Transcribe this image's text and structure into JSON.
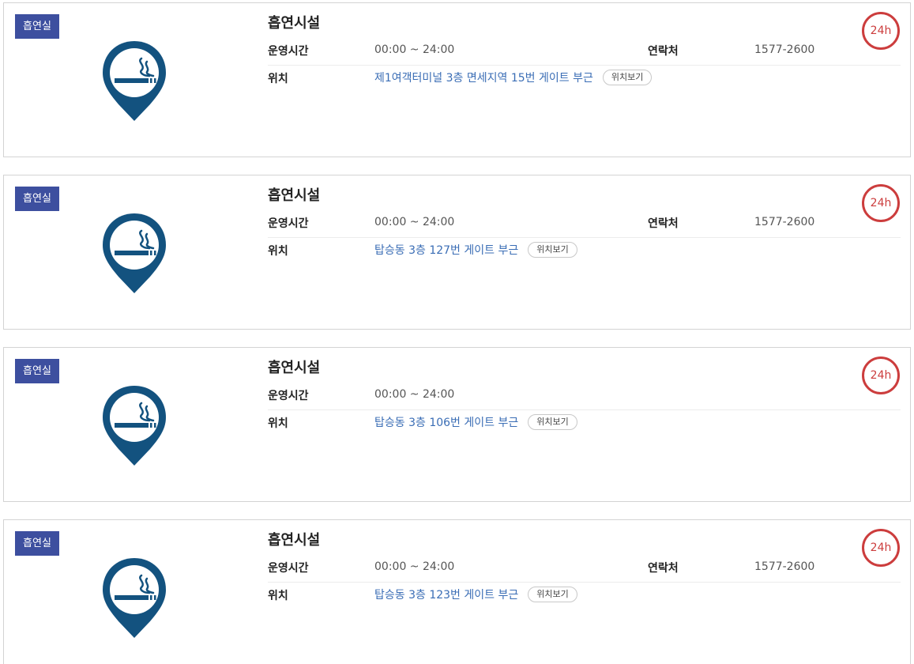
{
  "colors": {
    "badge_bg": "#3d4f9f",
    "pin": "#13527f",
    "ring": "#cc3d3d",
    "link": "#3a6db5"
  },
  "icons": {
    "pin": "smoking-area-pin-icon"
  },
  "facilities": [
    {
      "badge": "흡연실",
      "title": "흡연시설",
      "hours_label": "운영시간",
      "hours": "00:00 ~ 24:00",
      "contact_label": "연락처",
      "contact": "1577-2600",
      "location_label": "위치",
      "location": "제1여객터미널 3층 면세지역 15번 게이트 부근",
      "view_button": "위치보기",
      "ring": "24h"
    },
    {
      "badge": "흡연실",
      "title": "흡연시설",
      "hours_label": "운영시간",
      "hours": "00:00 ~ 24:00",
      "contact_label": "연락처",
      "contact": "1577-2600",
      "location_label": "위치",
      "location": "탑승동 3층 127번 게이트 부근",
      "view_button": "위치보기",
      "ring": "24h"
    },
    {
      "badge": "흡연실",
      "title": "흡연시설",
      "hours_label": "운영시간",
      "hours": "00:00 ~ 24:00",
      "location_label": "위치",
      "location": "탑승동 3층 106번 게이트 부근",
      "view_button": "위치보기",
      "ring": "24h"
    },
    {
      "badge": "흡연실",
      "title": "흡연시설",
      "hours_label": "운영시간",
      "hours": "00:00 ~ 24:00",
      "contact_label": "연락처",
      "contact": "1577-2600",
      "location_label": "위치",
      "location": "탑승동 3층 123번 게이트 부근",
      "view_button": "위치보기",
      "ring": "24h"
    }
  ]
}
